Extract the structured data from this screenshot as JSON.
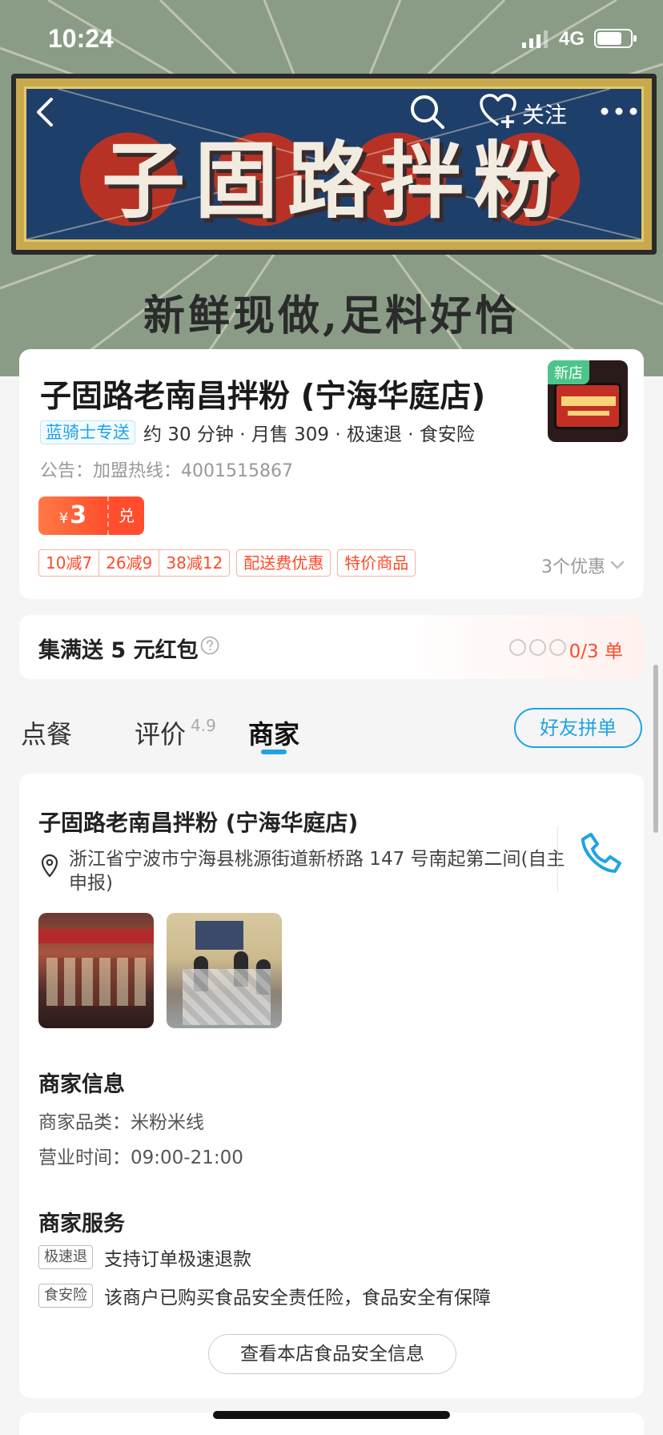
{
  "status_bar": {
    "time": "10:24",
    "network": "4G"
  },
  "banner": {
    "sign_title": "子固路拌粉",
    "slogan": "新鲜现做,足料好恰",
    "colors": {
      "background": "#8a9c86",
      "sign": "#1f3f6b",
      "frame": "#c9a94e"
    }
  },
  "nav": {
    "back_icon": "chevron-left-icon",
    "search_icon": "search-icon",
    "follow_icon": "heart-plus-icon",
    "follow_label": "关注",
    "more_icon": "more-dots-icon"
  },
  "shop": {
    "name": "子固路老南昌拌粉 (宁海华庭店)",
    "delivery_tag": "蓝骑士专送",
    "meta": "约 30 分钟 · 月售 309 · 极速退 · 食安险",
    "notice": "公告：加盟热线：4001515867",
    "logo_badge": "新店",
    "coupon": {
      "symbol": "¥",
      "amount": "3",
      "action": "兑"
    },
    "promotions": [
      "10减7",
      "26减9",
      "38减12"
    ],
    "promo_tags": [
      "配送费优惠",
      "特价商品"
    ],
    "promo_more": "3个优惠",
    "accent": "#ff4a2a"
  },
  "red_packet": {
    "title": "集满送 5 元红包",
    "progress": "0/3 单",
    "collected": 0,
    "total": 3
  },
  "tabs": {
    "order": "点餐",
    "review": "评价",
    "rating": "4.9",
    "merchant": "商家",
    "group_order": "好友拼单",
    "active": "商家",
    "accent": "#1fa3e5"
  },
  "merchant": {
    "name": "子固路老南昌拌粉 (宁海华庭店)",
    "address": "浙江省宁波市宁海县桃源街道新桥路 147 号南起第二间(自主申报)",
    "phone_icon": "phone-icon",
    "info_title": "商家信息",
    "category": "商家品类：米粉米线",
    "hours": "营业时间：09:00-21:00",
    "service_title": "商家服务",
    "services": [
      {
        "tag": "极速退",
        "text": "支持订单极速退款"
      },
      {
        "tag": "食安险",
        "text": "该商户已购买食品安全责任险，食品安全有保障"
      }
    ],
    "safety_button": "查看本店食品安全信息"
  }
}
